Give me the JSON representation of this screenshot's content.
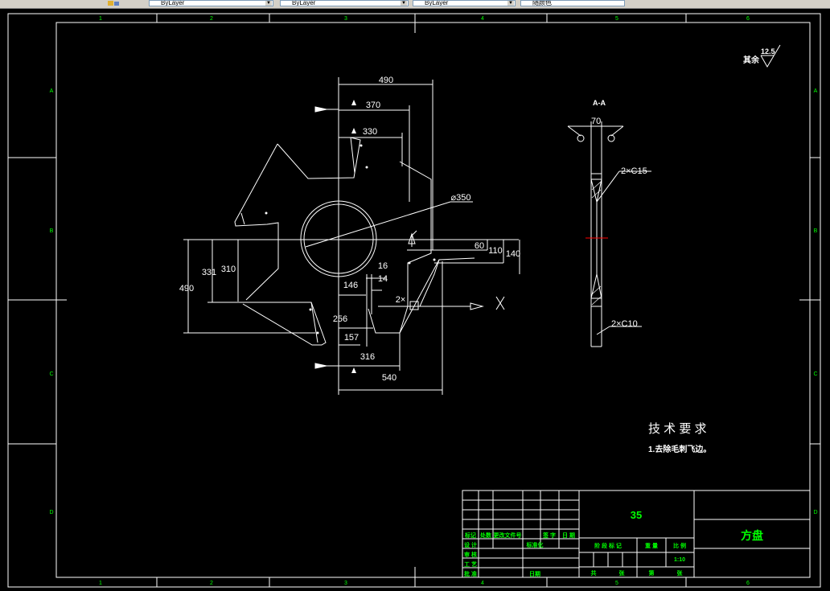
{
  "toolbar": {
    "layer_combo_1": "ByLayer",
    "layer_combo_2": "ByLayer",
    "layer_combo_3": "ByLayer",
    "layer_combo_4": "随颜色"
  },
  "border": {
    "top_cols": [
      "1",
      "2",
      "3",
      "4",
      "5",
      "6"
    ],
    "bottom_cols": [
      "1",
      "2",
      "3",
      "4",
      "5",
      "6"
    ],
    "left_rows": [
      "A",
      "B",
      "C",
      "D"
    ],
    "right_rows": [
      "A",
      "B",
      "C",
      "D"
    ]
  },
  "roughness": {
    "prefix": "其余",
    "value": "12.5"
  },
  "section_label": "A-A",
  "dimensions": {
    "d490_top": "490",
    "d370": "370",
    "d330": "330",
    "d350": "⌀350",
    "d60": "60",
    "d110": "110",
    "d140": "140",
    "d331": "331",
    "d310": "310",
    "d490_left": "490",
    "d16": "16",
    "d14": "14",
    "d146": "146",
    "d2x": "2×",
    "d256": "256",
    "d157": "157",
    "d316": "316",
    "d540": "540",
    "x_mark": "X",
    "d70": "70",
    "c15": "2×C15",
    "c10": "2×C10"
  },
  "tech": {
    "title": "技 术 要 求",
    "line1": "1.去除毛刺飞边。"
  },
  "title_block": {
    "material": "35",
    "part_name": "方盘",
    "headers_row": [
      "标记",
      "处数",
      "更改文件号",
      "签 字",
      "日 期"
    ],
    "sign_rows": [
      "设 计",
      "审 核",
      "工 艺",
      "批 准"
    ],
    "standard": "标准化",
    "date": "日期",
    "stage": "阶 段 标 记",
    "weight": "重 量",
    "scale": "比 例",
    "scale_value": "1:10",
    "sheet_total": "共",
    "sheet_label": "张",
    "sheet_no": "第",
    "sheet_label2": "张"
  },
  "colors": {
    "background": "#000000",
    "line": "#ffffff",
    "text": "#ffffff",
    "green": "#00ff00",
    "red": "#ff0000"
  }
}
